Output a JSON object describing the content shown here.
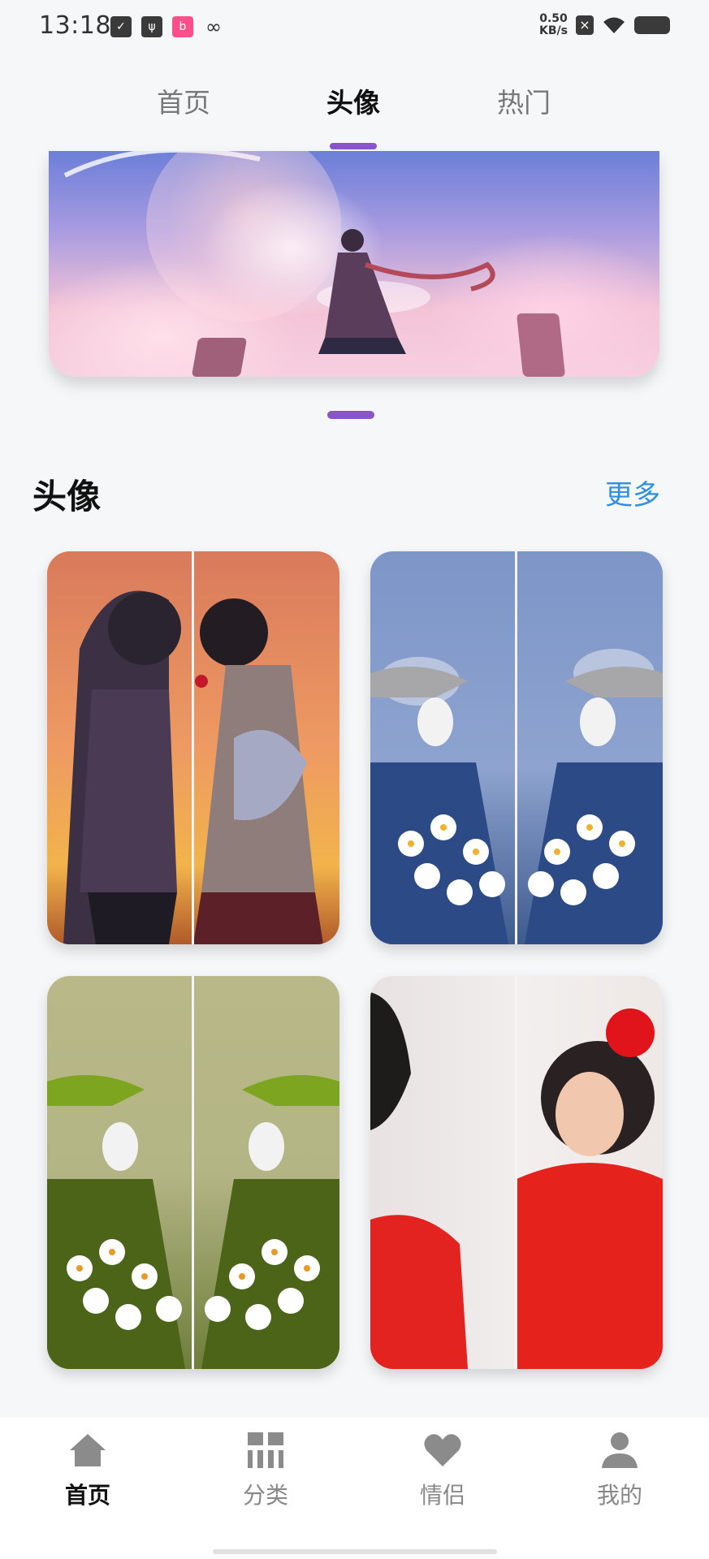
{
  "status_bar": {
    "time": "13:18",
    "network_speed_value": "0.50",
    "network_speed_unit": "KB/s",
    "icons": [
      "clipboard-check-icon",
      "usb-icon",
      "bilibili-icon",
      "link-icon",
      "close-box-icon",
      "wifi-icon",
      "battery-icon"
    ]
  },
  "top_tabs": [
    {
      "label": "首页",
      "active": false
    },
    {
      "label": "头像",
      "active": true
    },
    {
      "label": "热门",
      "active": false
    }
  ],
  "section": {
    "title": "头像",
    "more_label": "更多"
  },
  "bottom_nav": [
    {
      "label": "首页",
      "icon": "home-icon",
      "active": true
    },
    {
      "label": "分类",
      "icon": "grid-icon",
      "active": false
    },
    {
      "label": "情侣",
      "icon": "heart-icon",
      "active": false
    },
    {
      "label": "我的",
      "icon": "person-icon",
      "active": false
    }
  ],
  "colors": {
    "accent": "#8a55c8",
    "link": "#2f8fe0",
    "background": "#f6f7f9"
  }
}
